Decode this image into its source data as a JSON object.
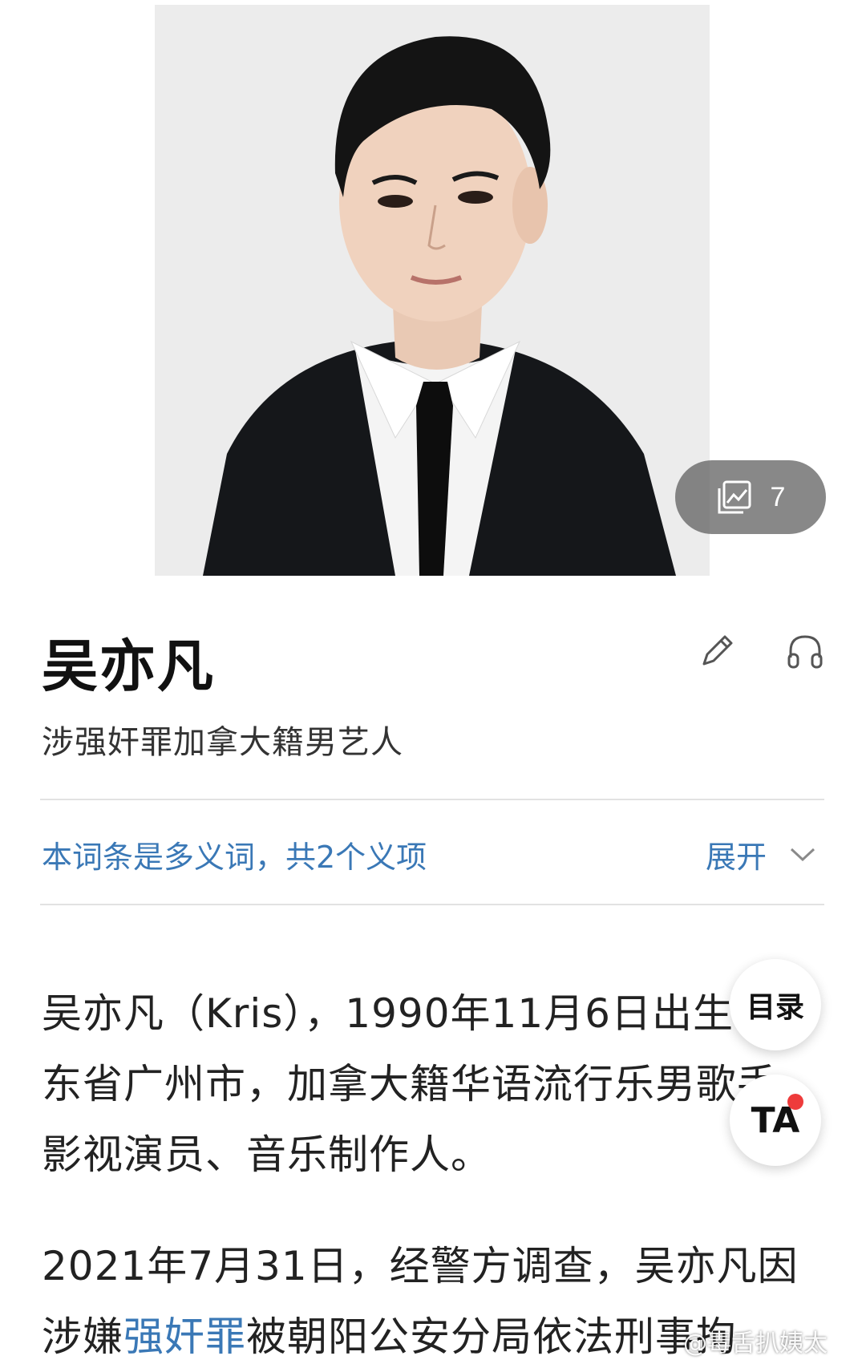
{
  "hero": {
    "gallery_count": "7",
    "gallery_icon": "image-gallery-icon"
  },
  "entry": {
    "title": "吴亦凡",
    "subtitle": "涉强奸罪加拿大籍男艺人",
    "edit_icon": "pencil-icon",
    "listen_icon": "headphones-icon"
  },
  "disambiguation": {
    "text": "本词条是多义词，共2个义项",
    "expand_label": "展开",
    "expand_icon": "chevron-down-icon"
  },
  "intro": {
    "p1": "吴亦凡（Kris），1990年11月6日出生于广东省广州市，加拿大籍华语流行乐男歌手、影视演员、音乐制作人。",
    "p2_before": "2021年7月31日，经警方调查，吴亦凡因涉嫌",
    "p2_link": "强奸罪",
    "p2_after": "被朝阳公安分局依法刑事拘"
  },
  "floating": {
    "toc_label": "目录",
    "ta_label": "TA"
  },
  "watermark": "@毒舌扒姨太",
  "colors": {
    "link": "#3a78b6",
    "title": "#111111",
    "badge_dot": "#ee3b3b"
  }
}
